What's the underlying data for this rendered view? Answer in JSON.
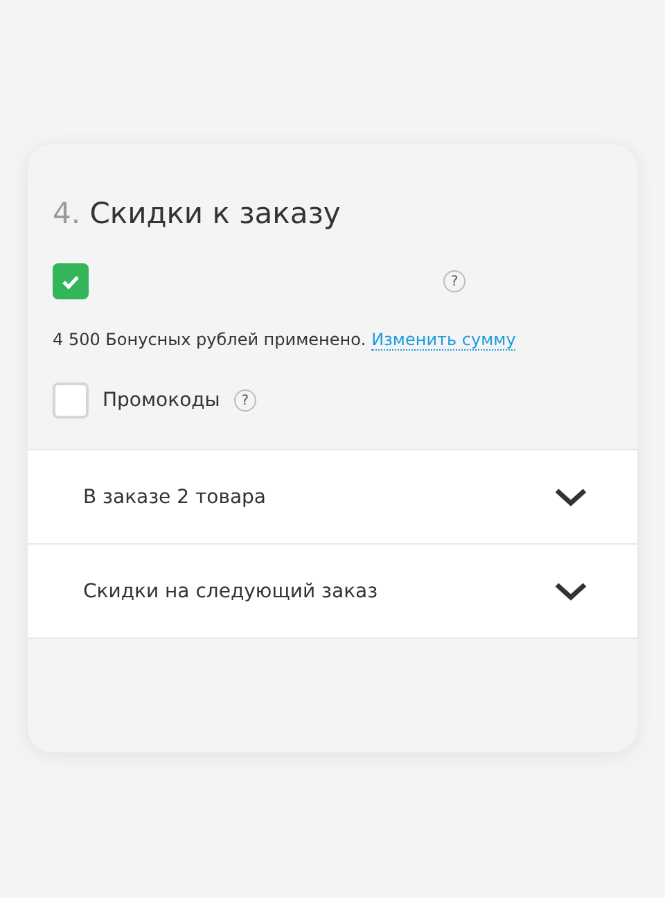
{
  "section": {
    "number": "4.",
    "title": "Скидки к заказу"
  },
  "bonus_option": {
    "checked": true,
    "help": "?"
  },
  "bonus_note": {
    "text": "4 500 Бонусных рублей применено.",
    "link": "Изменить сумму"
  },
  "promo_option": {
    "label": "Промокоды",
    "checked": false,
    "help": "?"
  },
  "accordion": [
    {
      "label": "В заказе 2 товара",
      "expanded": false
    },
    {
      "label": "Скидки на следующий заказ",
      "expanded": false
    }
  ]
}
